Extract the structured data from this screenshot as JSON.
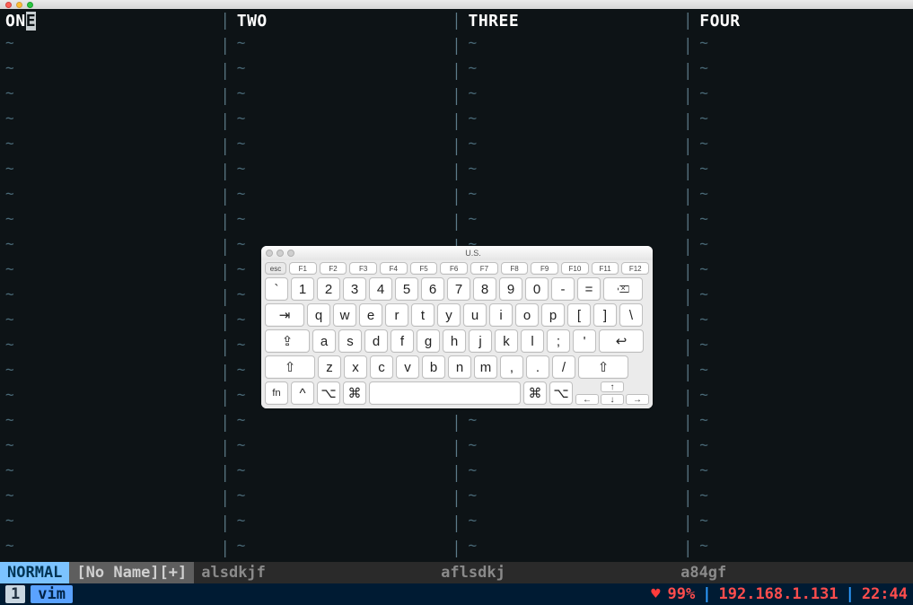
{
  "macos_title": "",
  "panes": [
    {
      "title_pre": "ON",
      "title_cursor": "E",
      "title_post": ""
    },
    {
      "title_pre": "TWO",
      "title_cursor": "",
      "title_post": ""
    },
    {
      "title_pre": "THREE",
      "title_cursor": "",
      "title_post": ""
    },
    {
      "title_pre": "FOUR",
      "title_cursor": "",
      "title_post": ""
    }
  ],
  "tilde_glyph": "~",
  "separator_glyph": "│",
  "tilde_rows": 21,
  "sep_rows": 22,
  "statusline": {
    "mode": "NORMAL",
    "file": "[No Name][+]",
    "segments": [
      "alsdkjf",
      "aflsdkj",
      "a84gf"
    ]
  },
  "tmux": {
    "session_num": "1",
    "window_name": "vim",
    "heart": "♥",
    "battery_pct": "99%",
    "sep": "|",
    "ip": "192.168.1.131",
    "clock": "22:44"
  },
  "keyboard": {
    "title": "U.S.",
    "esc": "esc",
    "frow": [
      "F1",
      "F2",
      "F3",
      "F4",
      "F5",
      "F6",
      "F7",
      "F8",
      "F9",
      "F10",
      "F11",
      "F12"
    ],
    "row1": [
      "`",
      "1",
      "2",
      "3",
      "4",
      "5",
      "6",
      "7",
      "8",
      "9",
      "0",
      "-",
      "="
    ],
    "backspace_icon": "bksp",
    "row2": [
      "q",
      "w",
      "e",
      "r",
      "t",
      "y",
      "u",
      "i",
      "o",
      "p",
      "[",
      "]",
      "\\"
    ],
    "tab_icon": "⇥",
    "row3": [
      "a",
      "s",
      "d",
      "f",
      "g",
      "h",
      "j",
      "k",
      "l",
      ";",
      "'"
    ],
    "caps_icon": "⇪",
    "return_icon": "↩",
    "row4": [
      "z",
      "x",
      "c",
      "v",
      "b",
      "n",
      "m",
      ",",
      ".",
      "/"
    ],
    "shift_icon": "⇧",
    "row5": {
      "fn_label": "fn",
      "ctrl_icon": "^",
      "opt_icon": "⌥",
      "cmd_icon": "⌘",
      "arrows": {
        "up": "↑",
        "down": "↓",
        "left": "←",
        "right": "→"
      }
    }
  }
}
